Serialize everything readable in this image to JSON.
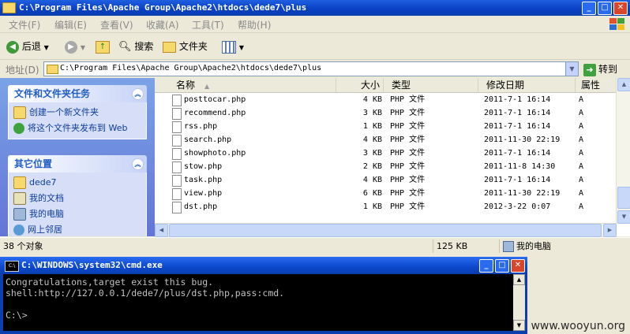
{
  "explorer": {
    "title": "C:\\Program Files\\Apache Group\\Apache2\\htdocs\\dede7\\plus",
    "menu": [
      "文件(F)",
      "编辑(E)",
      "查看(V)",
      "收藏(A)",
      "工具(T)",
      "帮助(H)"
    ],
    "toolbar": {
      "back_label": "后退",
      "search_label": "搜索",
      "folders_label": "文件夹"
    },
    "address": {
      "label": "地址(D)",
      "value": "C:\\Program Files\\Apache Group\\Apache2\\htdocs\\dede7\\plus",
      "go_label": "转到"
    },
    "tasks": {
      "title": "文件和文件夹任务",
      "items": [
        "创建一个新文件夹",
        "将这个文件夹发布到 Web"
      ]
    },
    "places": {
      "title": "其它位置",
      "items": [
        "dede7",
        "我的文档",
        "我的电脑",
        "网上邻居"
      ]
    },
    "columns": {
      "name": "名称",
      "size": "大小",
      "type": "类型",
      "date": "修改日期",
      "attr": "属性"
    },
    "files": [
      {
        "name": "posttocar.php",
        "size": "4 KB",
        "type": "PHP 文件",
        "date": "2011-7-1 16:14",
        "attr": "A"
      },
      {
        "name": "recommend.php",
        "size": "3 KB",
        "type": "PHP 文件",
        "date": "2011-7-1 16:14",
        "attr": "A"
      },
      {
        "name": "rss.php",
        "size": "1 KB",
        "type": "PHP 文件",
        "date": "2011-7-1 16:14",
        "attr": "A"
      },
      {
        "name": "search.php",
        "size": "4 KB",
        "type": "PHP 文件",
        "date": "2011-11-30 22:19",
        "attr": "A"
      },
      {
        "name": "showphoto.php",
        "size": "3 KB",
        "type": "PHP 文件",
        "date": "2011-7-1 16:14",
        "attr": "A"
      },
      {
        "name": "stow.php",
        "size": "2 KB",
        "type": "PHP 文件",
        "date": "2011-11-8 14:30",
        "attr": "A"
      },
      {
        "name": "task.php",
        "size": "4 KB",
        "type": "PHP 文件",
        "date": "2011-7-1 16:14",
        "attr": "A"
      },
      {
        "name": "view.php",
        "size": "6 KB",
        "type": "PHP 文件",
        "date": "2011-11-30 22:19",
        "attr": "A"
      },
      {
        "name": "dst.php",
        "size": "1 KB",
        "type": "PHP 文件",
        "date": "2012-3-22 0:07",
        "attr": "A"
      }
    ],
    "status": {
      "objects": "38 个对象",
      "size": "125 KB",
      "location": "我的电脑"
    }
  },
  "console": {
    "title": "C:\\WINDOWS\\system32\\cmd.exe",
    "lines": [
      "Congratulations,target exist this bug.",
      "shell:http://127.0.0.1/dede7/plus/dst.php,pass:cmd.",
      "",
      "C:\\>"
    ]
  },
  "watermark": "www.wooyun.org"
}
